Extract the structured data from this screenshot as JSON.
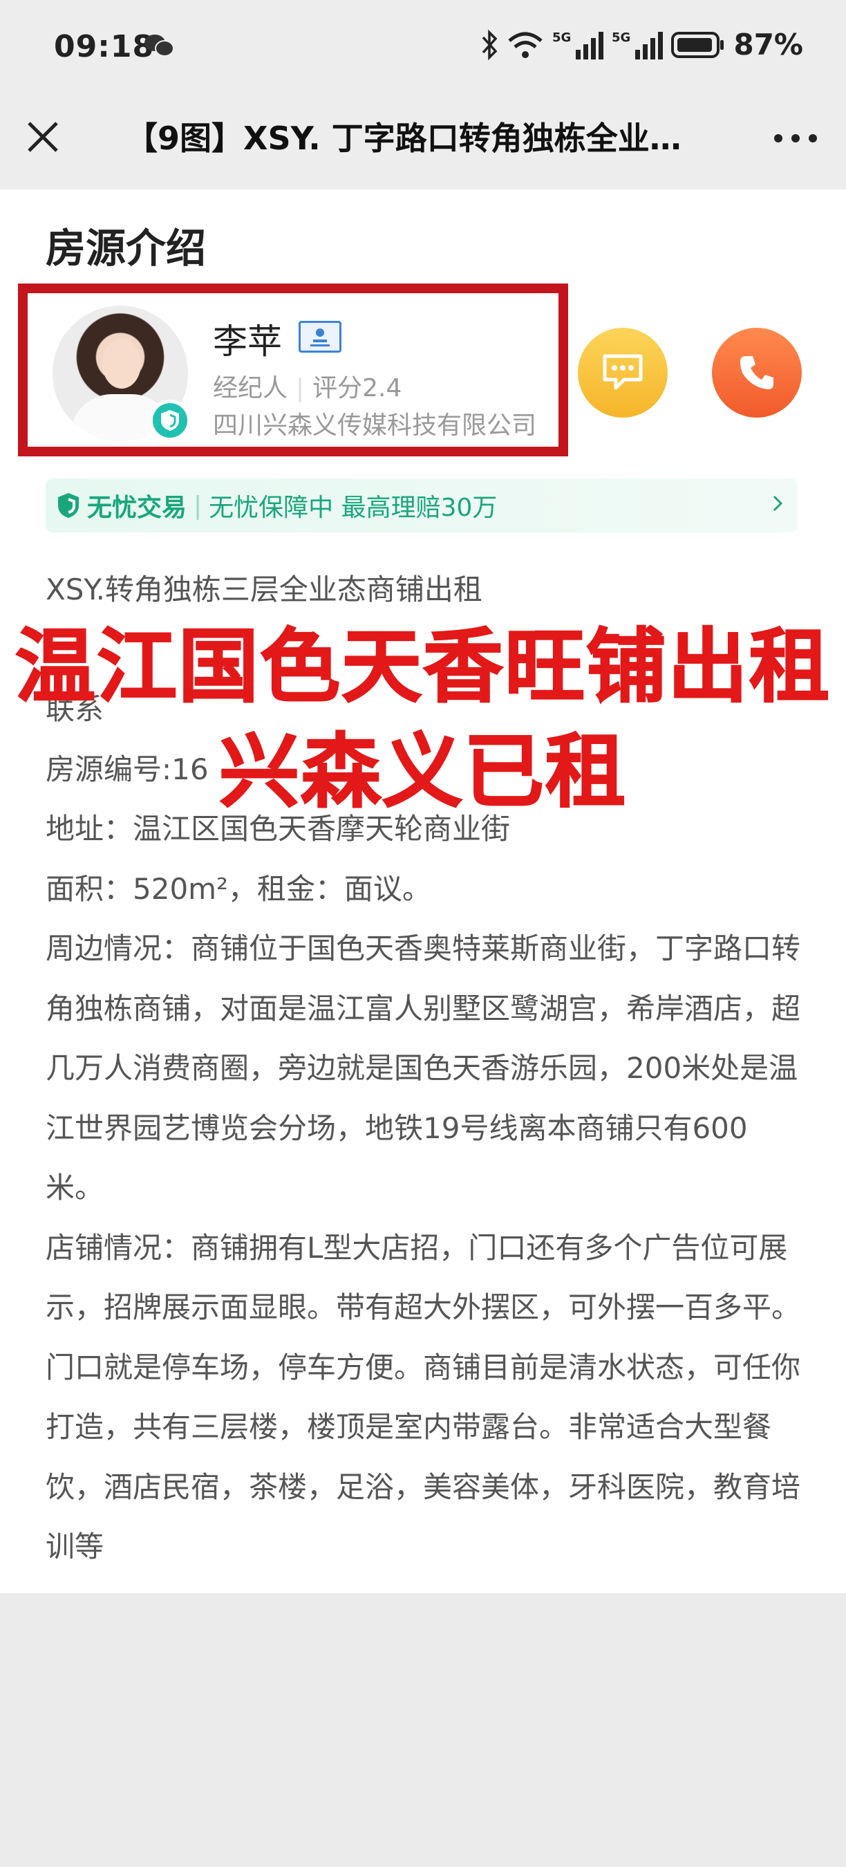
{
  "status_bar": {
    "time": "09:18",
    "battery": "87%",
    "icons": [
      "wechat-icon",
      "bluetooth-icon",
      "wifi-icon",
      "5g-signal-icon",
      "5g-signal-icon",
      "battery-icon"
    ]
  },
  "nav": {
    "title": "【9图】XSY. 丁字路口转角独栋全业…",
    "close_icon": "close-icon",
    "more_icon": "more-icon"
  },
  "section": {
    "title": "房源介绍"
  },
  "agent": {
    "name": "李苹",
    "role": "经纪人",
    "rating": "评分2.4",
    "company": "四川兴森义传媒科技有限公司"
  },
  "guarantee": {
    "brand": "无忧交易",
    "text": "无忧保障中 最高理赔30万"
  },
  "description": {
    "lines": [
      "XSY.转角独栋三层全业态商铺出租",
      "",
      "联系",
      "房源编号:16",
      "地址：温江区国色天香摩天轮商业街",
      "面积：520m²，租金：面议。",
      "周边情况：商铺位于国色天香奥特莱斯商业街，丁字路口转角独栋商铺，对面是温江富人别墅区鹭湖宫，希岸酒店，超几万人消费商圈，旁边就是国色天香游乐园，200米处是温江世界园艺博览会分场，地铁19号线离本商铺只有600米。",
      "店铺情况：商铺拥有L型大店招，门口还有多个广告位可展示，招牌展示面显眼。带有超大外摆区，可外摆一百多平。门口就是停车场，停车方便。商铺目前是清水状态，可任你打造，共有三层楼，楼顶是室内带露台。非常适合大型餐饮，酒店民宿，茶楼，足浴，美容美体，牙科医院，教育培训等"
    ]
  },
  "overlay": {
    "line1": "温江国色天香旺铺出租",
    "line2": "兴森义已租"
  },
  "colors": {
    "accent_red": "#e31818",
    "frame_red": "#c4151c",
    "green": "#1aa67d"
  }
}
